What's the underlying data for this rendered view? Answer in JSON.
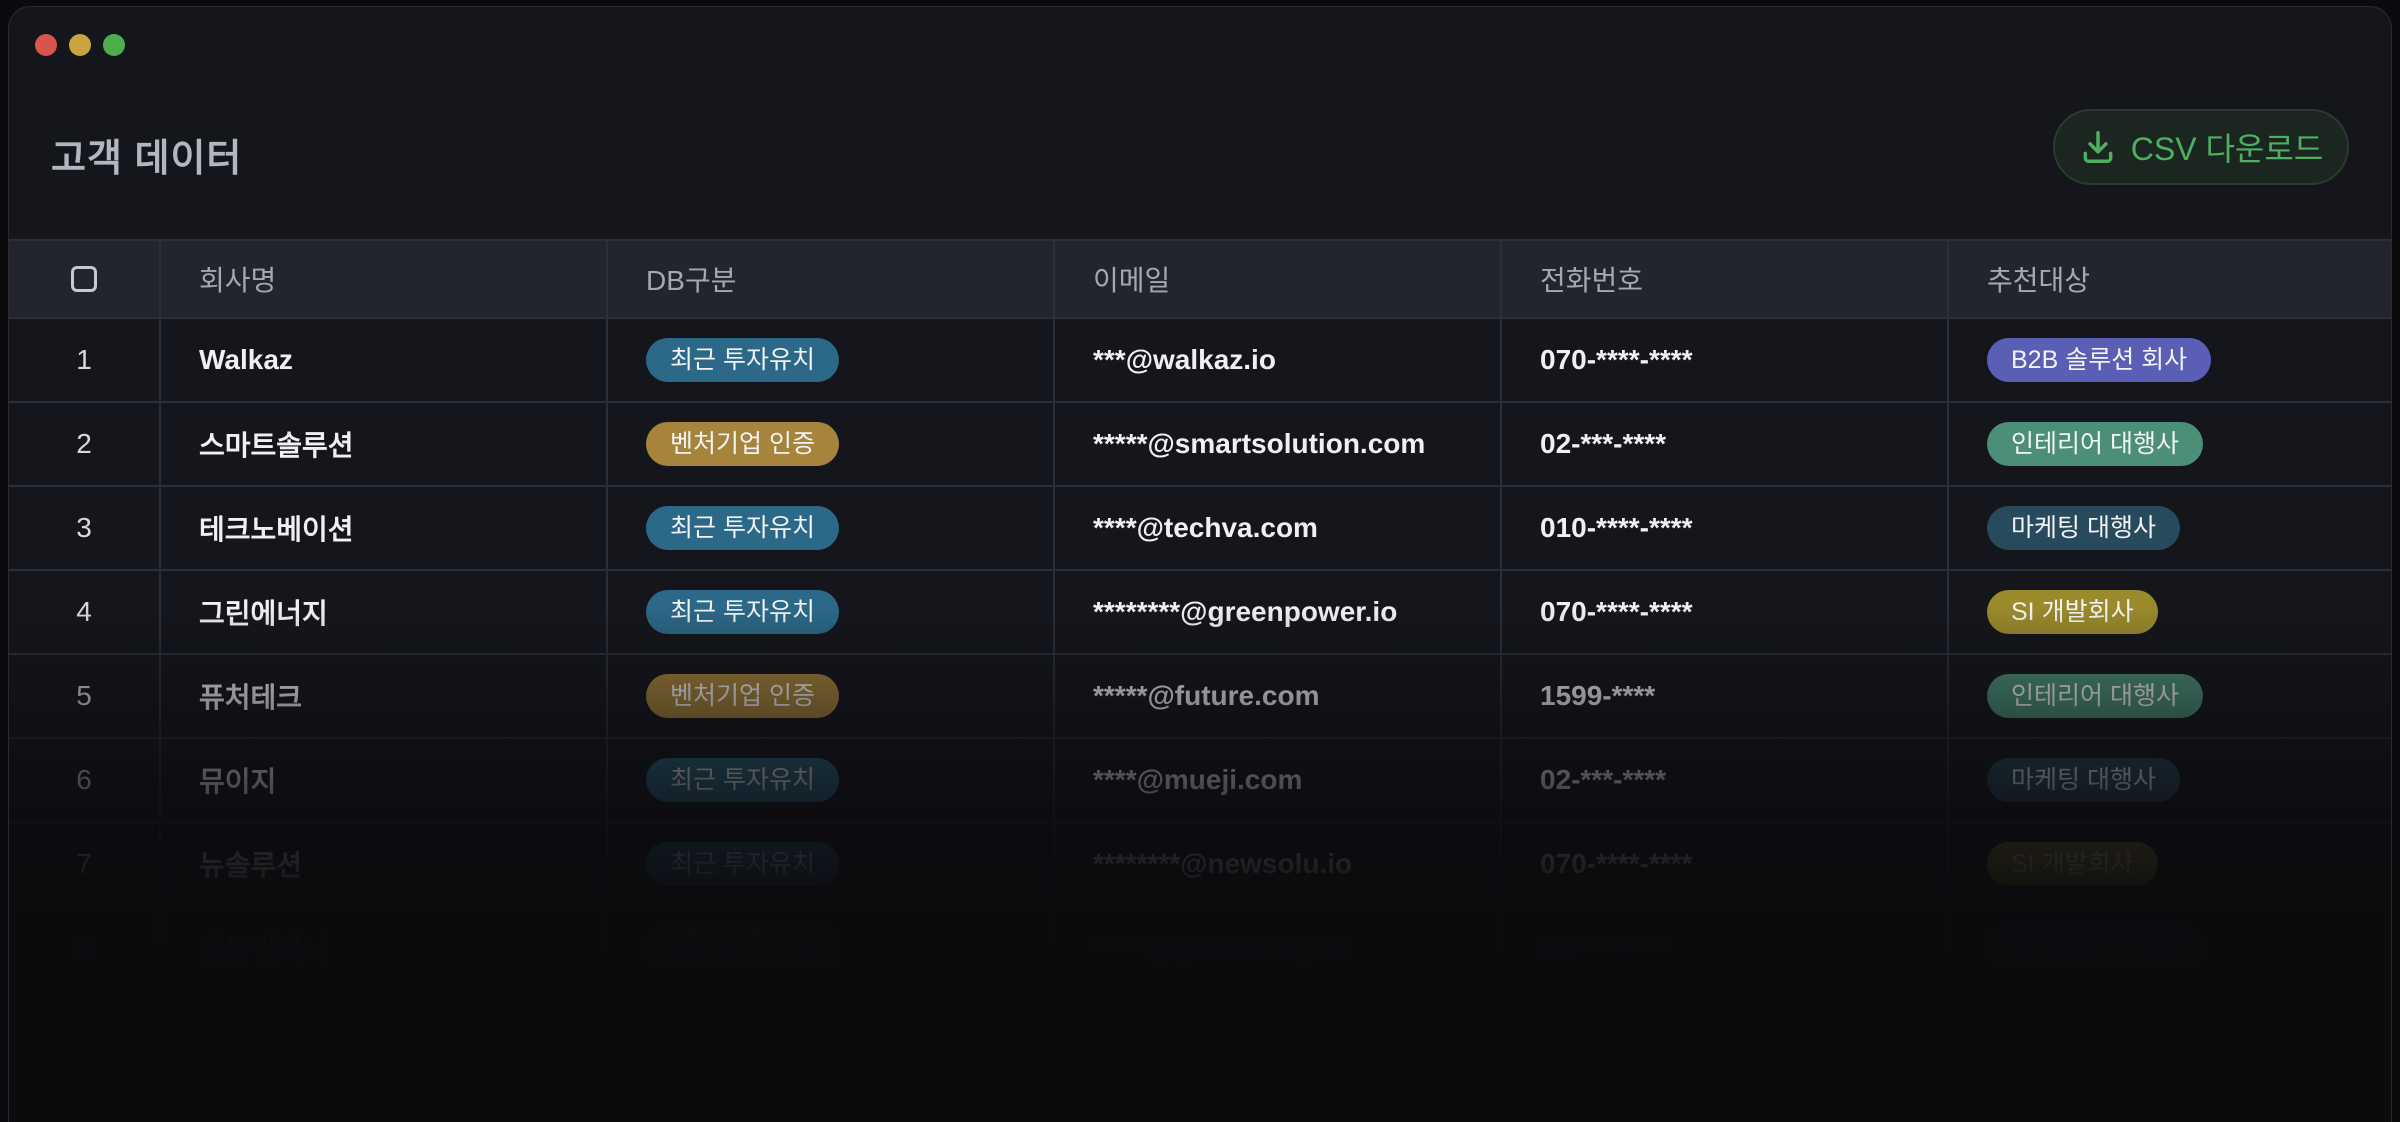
{
  "window": {
    "controls": [
      "close",
      "minimize",
      "maximize"
    ]
  },
  "page": {
    "title": "고객 데이터",
    "download_button": "CSV 다운로드",
    "download_icon": "download-icon"
  },
  "colors": {
    "badge_invest": "#2c6887",
    "badge_venture": "#a6843b",
    "badge_b2b": "#5a5eb4",
    "badge_interior": "#4b8f78",
    "badge_marketing": "#284a5d",
    "badge_si": "#9a8a2c",
    "accent_green": "#4fae62"
  },
  "table": {
    "columns": [
      "회사명",
      "DB구분",
      "이메일",
      "전화번호",
      "추천대상"
    ],
    "rows": [
      {
        "no": "1",
        "company": "Walkaz",
        "db": "최근 투자유치",
        "email": "***@walkaz.io",
        "phone": "070-****-****",
        "target": "B2B 솔루션 회사"
      },
      {
        "no": "2",
        "company": "스마트솔루션",
        "db": "벤처기업 인증",
        "email": "*****@smartsolution.com",
        "phone": "02-***-****",
        "target": "인테리어 대행사"
      },
      {
        "no": "3",
        "company": "테크노베이션",
        "db": "최근 투자유치",
        "email": "****@techva.com",
        "phone": "010-****-****",
        "target": "마케팅 대행사"
      },
      {
        "no": "4",
        "company": "그린에너지",
        "db": "최근 투자유치",
        "email": "********@greenpower.io",
        "phone": "070-****-****",
        "target": "SI 개발회사"
      },
      {
        "no": "5",
        "company": "퓨처테크",
        "db": "벤처기업 인증",
        "email": "*****@future.com",
        "phone": "1599-****",
        "target": "인테리어 대행사"
      },
      {
        "no": "6",
        "company": "뮤이지",
        "db": "최근 투자유치",
        "email": "****@mueji.com",
        "phone": "02-***-****",
        "target": "마케팅 대행사"
      },
      {
        "no": "7",
        "company": "뉴솔루션",
        "db": "최근 투자유치",
        "email": "********@newsolu.io",
        "phone": "070-****-****",
        "target": "SI 개발회사"
      },
      {
        "no": "8",
        "company": "젠틀컴퍼니",
        "db": "벤처기업 인증",
        "email": "*****@gentlecorp.io",
        "phone": "02-***-****",
        "target": "인테리어 대행사"
      }
    ]
  }
}
